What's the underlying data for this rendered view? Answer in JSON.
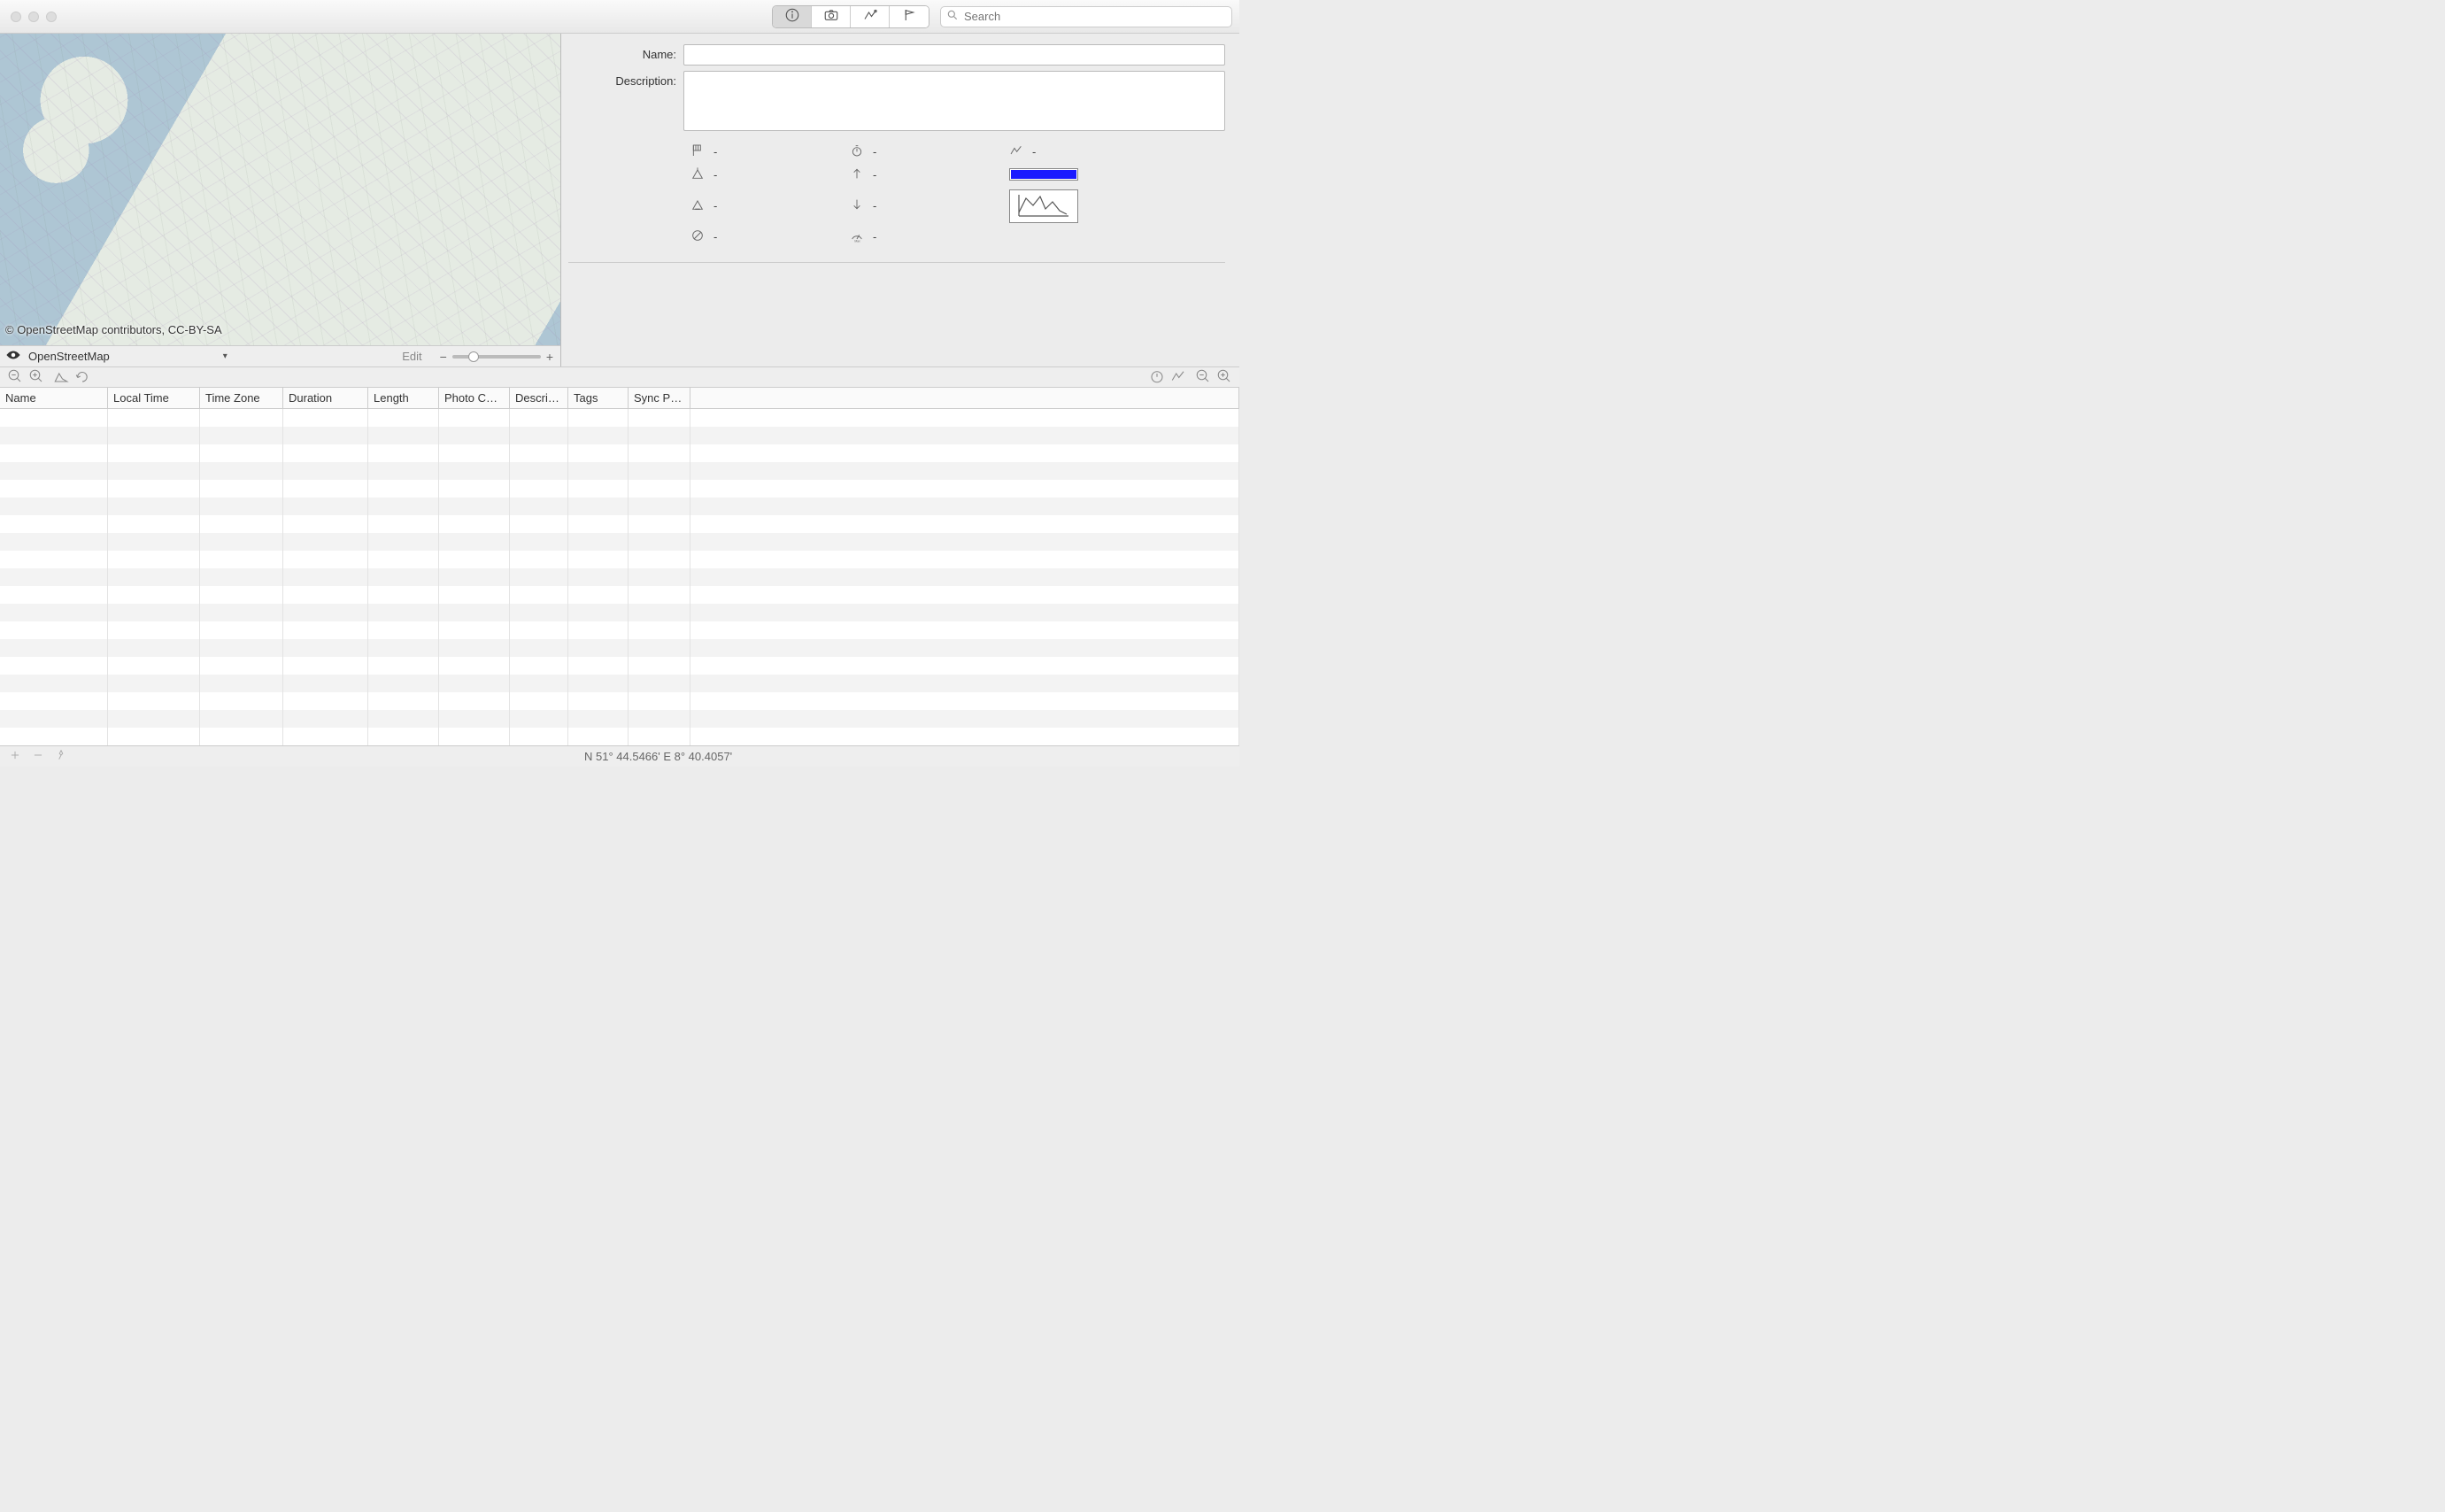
{
  "toolbar": {
    "search_placeholder": "Search"
  },
  "map": {
    "credit": "© OpenStreetMap contributors, CC-BY-SA",
    "source": "OpenStreetMap",
    "edit_label": "Edit"
  },
  "detail": {
    "name_label": "Name:",
    "description_label": "Description:",
    "name_value": "",
    "description_value": "",
    "stats": {
      "distance": "-",
      "duration": "-",
      "track": "-",
      "elevation_max": "-",
      "ascent": "-",
      "elevation_min": "-",
      "descent": "-",
      "avg": "-",
      "max_speed": "-"
    },
    "track_color": "#1a1aff"
  },
  "table": {
    "columns": [
      "Name",
      "Local Time",
      "Time Zone",
      "Duration",
      "Length",
      "Photo Count",
      "Descripti…",
      "Tags",
      "Sync Pho…"
    ]
  },
  "status": {
    "coords": "N 51° 44.5466'  E 8° 40.4057'"
  }
}
